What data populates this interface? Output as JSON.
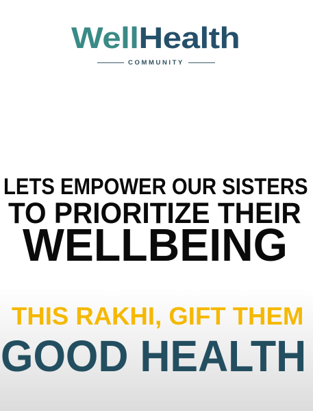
{
  "logo": {
    "word_part1": "Well",
    "word_part2": "Health",
    "subtitle": "COMMUNITY"
  },
  "headline": {
    "line1": "LETS EMPOWER OUR SISTERS",
    "line2": "TO PRIORITIZE THEIR",
    "line3": "WELLBEING"
  },
  "tagline": {
    "line1": "THIS RAKHI, GIFT THEM",
    "line2": "GOOD HEALTH"
  },
  "colors": {
    "teal_light": "#3a8a86",
    "teal_dark": "#234e60",
    "yellow": "#f5b800",
    "black": "#0a0a0a"
  }
}
